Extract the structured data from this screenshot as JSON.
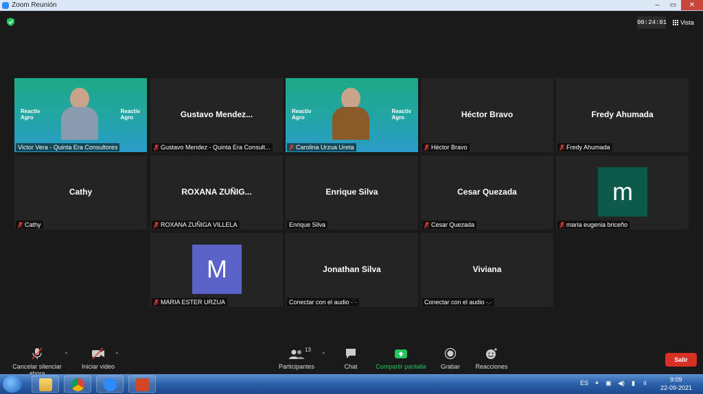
{
  "window": {
    "title": "Zoom Reunión",
    "min": "–",
    "max": "▭",
    "close": "✕"
  },
  "top": {
    "timer": "00:24:01",
    "view_label": "Vista"
  },
  "tiles": [
    {
      "name": "",
      "caption": "Victor Vera - Quinta Era Consultores",
      "muted": false,
      "video": true,
      "active": true
    },
    {
      "name": "Gustavo Mendez...",
      "caption": "Gustavo Mendez - Quinta Era Consult...",
      "muted": true
    },
    {
      "name": "",
      "caption": "Carolina Urzua Ureta",
      "muted": true,
      "video": true
    },
    {
      "name": "Héctor Bravo",
      "caption": "Héctor Bravo",
      "muted": true
    },
    {
      "name": "Fredy Ahumada",
      "caption": "Fredy Ahumada",
      "muted": true
    },
    {
      "name": "Cathy",
      "caption": "Cathy",
      "muted": true
    },
    {
      "name": "ROXANA ZUÑIG...",
      "caption": "ROXANA ZUÑIGA VILLELA",
      "muted": true
    },
    {
      "name": "Enrique Silva",
      "caption": "Enrique Silva",
      "muted": false
    },
    {
      "name": "Cesar Quezada",
      "caption": "Cesar Quezada",
      "muted": true
    },
    {
      "name": "",
      "caption": "maria eugenia briceño",
      "muted": true,
      "avatar": "m",
      "avatar_color": "#0e5a4a"
    },
    {
      "name": "",
      "caption": "MARIA ESTER URZUA",
      "muted": true,
      "avatar": "M",
      "avatar_color": "#5b63c9"
    },
    {
      "name": "Jonathan Silva",
      "caption": "Conectar con el audio ·˙·",
      "muted": false
    },
    {
      "name": "Viviana",
      "caption": "Conectar con el audio ·.·",
      "muted": false
    }
  ],
  "video_logo": {
    "line1": "Reactiv",
    "line2": "Agro"
  },
  "toolbar": {
    "mute": "Cancelar silenciar ahora",
    "video": "Iniciar video",
    "participants": "Participantes",
    "participants_count": "13",
    "chat": "Chat",
    "share": "Compartir pantalla",
    "record": "Grabar",
    "reactions": "Reacciones",
    "leave": "Salir"
  },
  "taskbar": {
    "lang": "ES",
    "time": "9:09",
    "date": "22-09-2021"
  },
  "colors": {
    "active_border": "#e8e86a",
    "share_green": "#22c55e",
    "leave_red": "#d93025"
  }
}
